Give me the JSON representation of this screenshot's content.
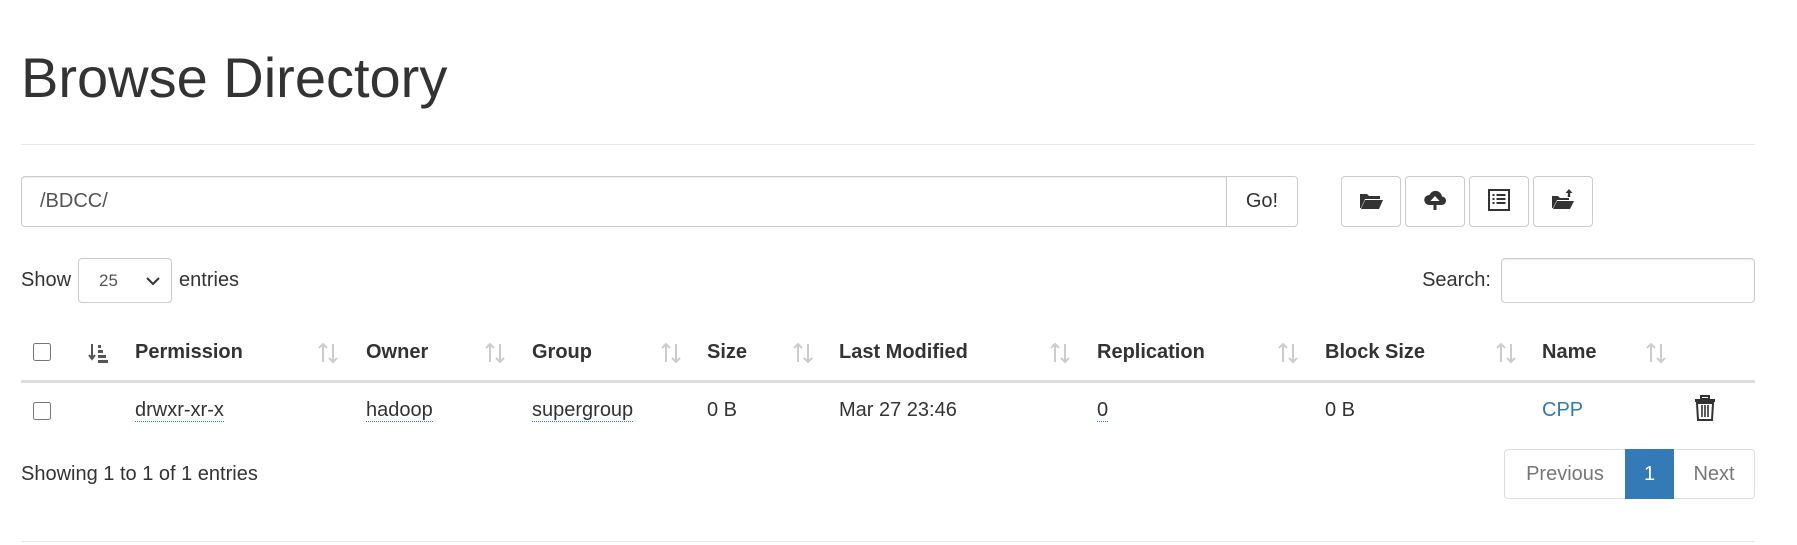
{
  "header": {
    "title": "Browse Directory"
  },
  "path_bar": {
    "value": "/BDCC/",
    "go_label": "Go!"
  },
  "toolbar": {
    "buttons": [
      {
        "icon": "folder-open-icon"
      },
      {
        "icon": "cloud-upload-icon"
      },
      {
        "icon": "list-alt-icon"
      },
      {
        "icon": "folder-upload-icon"
      }
    ]
  },
  "length": {
    "show_label": "Show",
    "selected": "25",
    "entries_label": "entries"
  },
  "search": {
    "label": "Search:",
    "value": ""
  },
  "table": {
    "columns": [
      "Permission",
      "Owner",
      "Group",
      "Size",
      "Last Modified",
      "Replication",
      "Block Size",
      "Name"
    ],
    "rows": [
      {
        "permission": "drwxr-xr-x",
        "owner": "hadoop",
        "group": "supergroup",
        "size": "0 B",
        "last_modified": "Mar 27 23:46",
        "replication": "0",
        "block_size": "0 B",
        "name": "CPP"
      }
    ]
  },
  "footer": {
    "info": "Showing 1 to 1 of 1 entries"
  },
  "pagination": {
    "previous": "Previous",
    "current": "1",
    "next": "Next"
  },
  "colors": {
    "accent": "#337ab7",
    "text": "#333333",
    "border": "#dddddd"
  }
}
